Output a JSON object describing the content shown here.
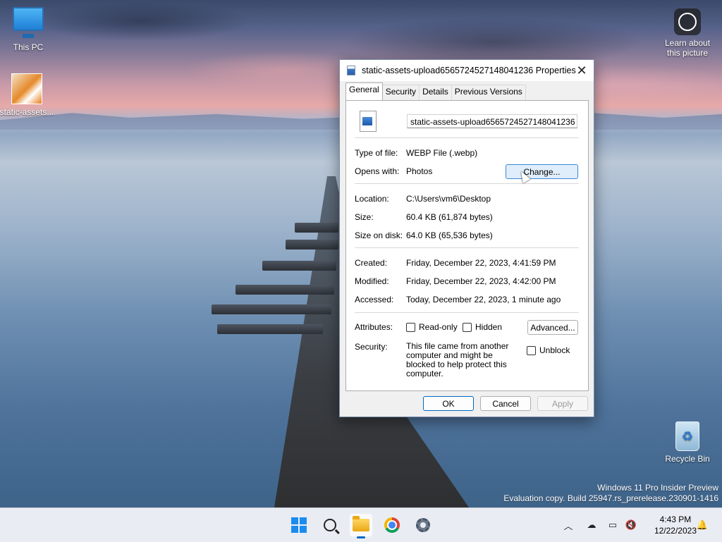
{
  "desktop": {
    "icons": [
      {
        "label": "This PC"
      },
      {
        "label": "static-assets..."
      },
      {
        "label": "Learn about this picture"
      },
      {
        "label": "Recycle Bin"
      }
    ],
    "watermark": {
      "line1": "Windows 11 Pro Insider Preview",
      "line2": "Evaluation copy. Build 25947.rs_prerelease.230901-1416"
    }
  },
  "dialog": {
    "title": "static-assets-upload6565724527148041236 Properties",
    "tabs": [
      "General",
      "Security",
      "Details",
      "Previous Versions"
    ],
    "active_tab": "General",
    "file_name": "static-assets-upload6565724527148041236",
    "labels": {
      "type": "Type of file:",
      "opens_with": "Opens with:",
      "location": "Location:",
      "size": "Size:",
      "size_on_disk": "Size on disk:",
      "created": "Created:",
      "modified": "Modified:",
      "accessed": "Accessed:",
      "attributes": "Attributes:",
      "security": "Security:"
    },
    "values": {
      "type": "WEBP File (.webp)",
      "opens_with": "Photos",
      "location": "C:\\Users\\vm6\\Desktop",
      "size": "60.4 KB (61,874 bytes)",
      "size_on_disk": "64.0 KB (65,536 bytes)",
      "created": "Friday, December 22, 2023, 4:41:59 PM",
      "modified": "Friday, December 22, 2023, 4:42:00 PM",
      "accessed": "Today, December 22, 2023, 1 minute ago",
      "security_text": "This file came from another computer and might be blocked to help protect this computer."
    },
    "buttons": {
      "change": "Change...",
      "advanced": "Advanced...",
      "ok": "OK",
      "cancel": "Cancel",
      "apply": "Apply"
    },
    "checkboxes": {
      "readonly": {
        "label": "Read-only",
        "checked": false
      },
      "hidden": {
        "label": "Hidden",
        "checked": false
      },
      "unblock": {
        "label": "Unblock",
        "checked": false
      }
    }
  },
  "taskbar": {
    "apps": [
      "windows-start",
      "search",
      "file-explorer",
      "chrome",
      "settings"
    ],
    "clock": {
      "time": "4:43 PM",
      "date": "12/22/2023"
    }
  }
}
